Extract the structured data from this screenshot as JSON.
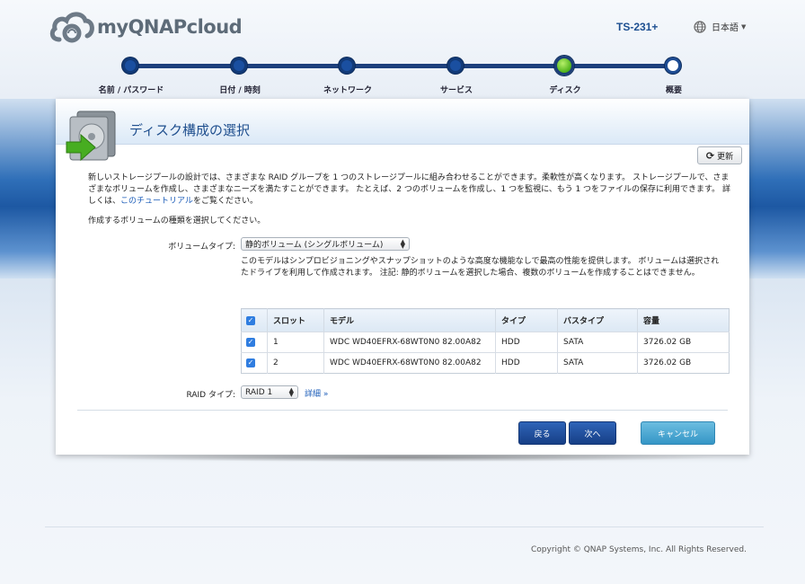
{
  "header": {
    "logo_text": "myQNAPcloud",
    "model": "TS-231+",
    "language": "日本語"
  },
  "steps": [
    {
      "label": "名前 / パスワード",
      "state": "done"
    },
    {
      "label": "日付 / 時刻",
      "state": "done"
    },
    {
      "label": "ネットワーク",
      "state": "done"
    },
    {
      "label": "サービス",
      "state": "done"
    },
    {
      "label": "ディスク",
      "state": "active"
    },
    {
      "label": "概要",
      "state": "pending"
    }
  ],
  "panel": {
    "title": "ディスク構成の選択",
    "refresh_label": "更新",
    "description": "新しいストレージプールの設計では、さまざまな RAID グループを 1 つのストレージプールに組み合わせることができます。柔軟性が高くなります。 ストレージプールで、さまざまなボリュームを作成し、さまざまなニーズを満たすことができます。 たとえば、2 つのボリュームを作成し、1 つを監視に、もう 1 つをファイルの保存に利用できます。 詳しくは、",
    "tutorial_link": "このチュートリアル",
    "description_end": "をご覧ください。",
    "choose_prompt": "作成するボリュームの種類を選択してください。",
    "volume_type_label": "ボリュームタイプ:",
    "volume_type_value": "静的ボリューム (シングルボリューム)",
    "volume_desc": "このモデルはシンプロビジョニングやスナップショットのような高度な機能なしで最高の性能を提供します。 ボリュームは選択されたドライブを利用して作成されます。 注記: 静的ボリュームを選択した場合、複数のボリュームを作成することはできません。",
    "table": {
      "headers": [
        "スロット",
        "モデル",
        "タイプ",
        "バスタイプ",
        "容量"
      ],
      "rows": [
        {
          "checked": true,
          "slot": "1",
          "model": "WDC WD40EFRX-68WT0N0 82.00A82",
          "type": "HDD",
          "bus": "SATA",
          "capacity": "3726.02 GB"
        },
        {
          "checked": true,
          "slot": "2",
          "model": "WDC WD40EFRX-68WT0N0 82.00A82",
          "type": "HDD",
          "bus": "SATA",
          "capacity": "3726.02 GB"
        }
      ]
    },
    "raid_label": "RAID タイプ:",
    "raid_value": "RAID 1",
    "detail_link": "詳細 »",
    "back_label": "戻る",
    "next_label": "次へ",
    "cancel_label": "キャンセル"
  },
  "footer": {
    "copyright": "Copyright © QNAP Systems, Inc. All Rights Reserved."
  },
  "colors": {
    "accent": "#1f4f8e",
    "active_step": "#4fb21a",
    "link": "#1a5bb8"
  }
}
